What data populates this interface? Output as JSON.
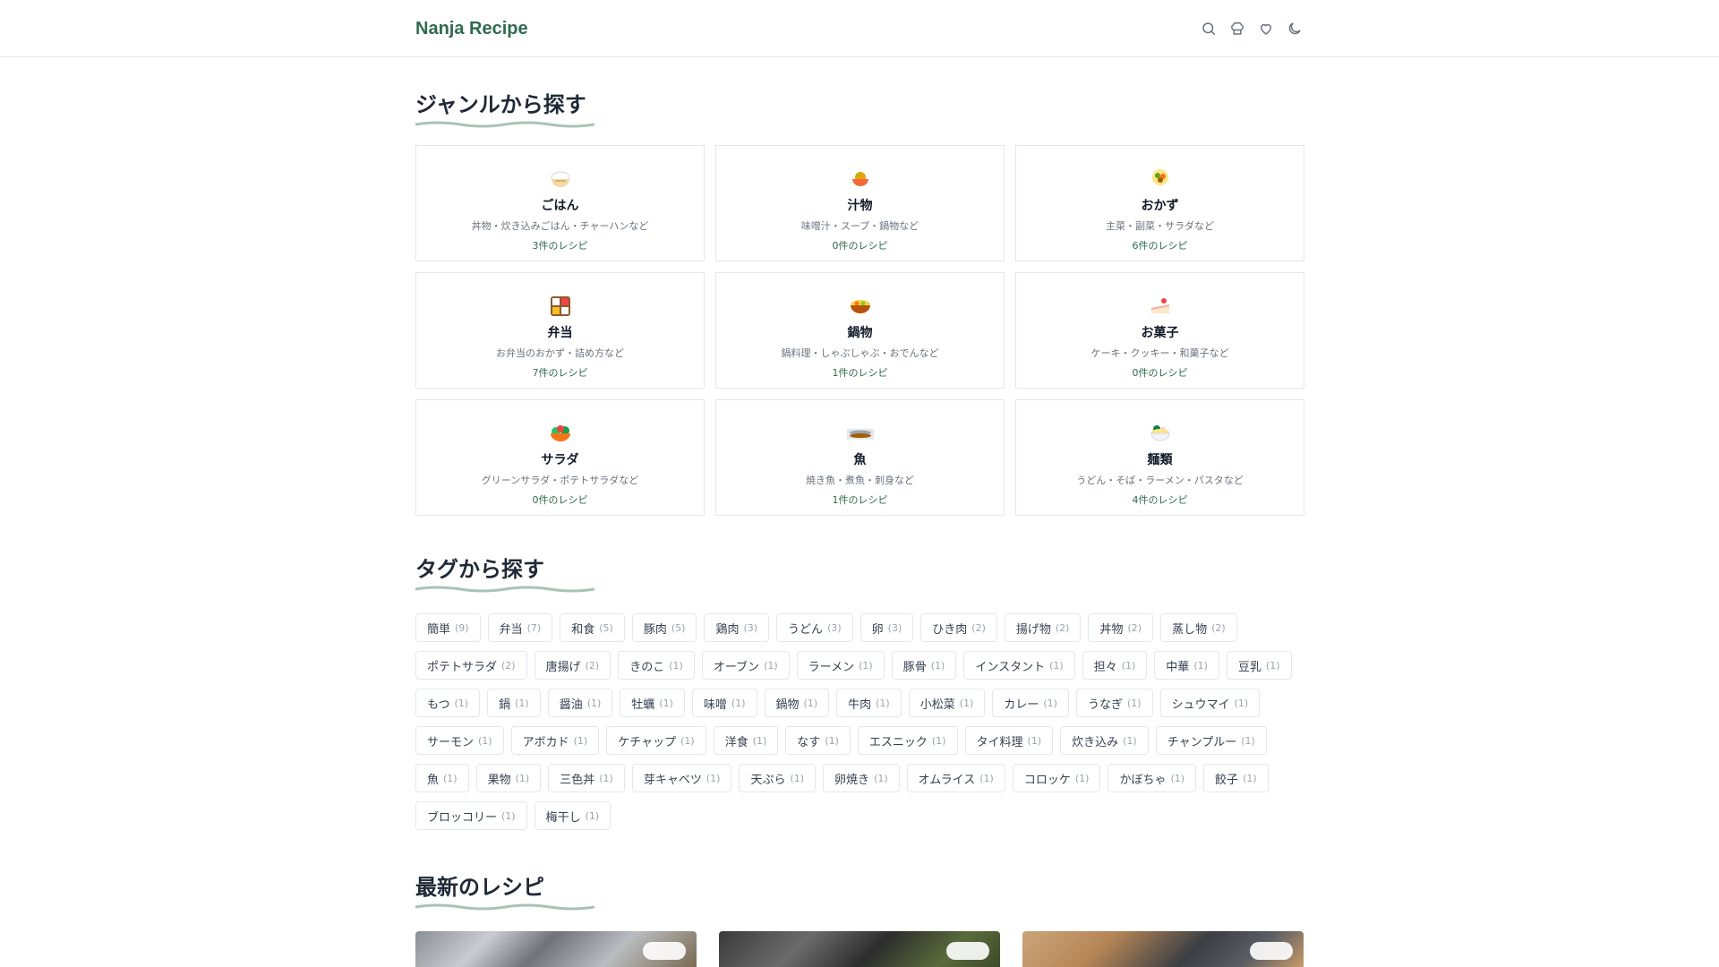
{
  "header": {
    "logo": "Nanja Recipe",
    "icons": [
      "search-icon",
      "chef-icon",
      "heart-icon",
      "moon-icon"
    ]
  },
  "genres_section": {
    "title": "ジャンルから探す",
    "items": [
      {
        "name": "ごはん",
        "desc": "丼物・炊き込みごはん・チャーハンなど",
        "count": "3件のレシピ",
        "icon": "rice-bowl-icon"
      },
      {
        "name": "汁物",
        "desc": "味噌汁・スープ・鍋物など",
        "count": "0件のレシピ",
        "icon": "soup-icon"
      },
      {
        "name": "おかず",
        "desc": "主菜・副菜・サラダなど",
        "count": "6件のレシピ",
        "icon": "side-dish-icon"
      },
      {
        "name": "弁当",
        "desc": "お弁当のおかず・詰め方など",
        "count": "7件のレシピ",
        "icon": "bento-icon"
      },
      {
        "name": "鍋物",
        "desc": "鍋料理・しゃぶしゃぶ・おでんなど",
        "count": "1件のレシピ",
        "icon": "hotpot-icon"
      },
      {
        "name": "お菓子",
        "desc": "ケーキ・クッキー・和菓子など",
        "count": "0件のレシピ",
        "icon": "cake-icon"
      },
      {
        "name": "サラダ",
        "desc": "グリーンサラダ・ポテトサラダなど",
        "count": "0件のレシピ",
        "icon": "salad-icon"
      },
      {
        "name": "魚",
        "desc": "焼き魚・煮魚・刺身など",
        "count": "1件のレシピ",
        "icon": "fish-icon"
      },
      {
        "name": "麺類",
        "desc": "うどん・そば・ラーメン・パスタなど",
        "count": "4件のレシピ",
        "icon": "noodles-icon"
      }
    ]
  },
  "tags_section": {
    "title": "タグから探す",
    "tags": [
      {
        "label": "簡単",
        "count": "(9)"
      },
      {
        "label": "弁当",
        "count": "(7)"
      },
      {
        "label": "和食",
        "count": "(5)"
      },
      {
        "label": "豚肉",
        "count": "(5)"
      },
      {
        "label": "鶏肉",
        "count": "(3)"
      },
      {
        "label": "うどん",
        "count": "(3)"
      },
      {
        "label": "卵",
        "count": "(3)"
      },
      {
        "label": "ひき肉",
        "count": "(2)"
      },
      {
        "label": "揚げ物",
        "count": "(2)"
      },
      {
        "label": "丼物",
        "count": "(2)"
      },
      {
        "label": "蒸し物",
        "count": "(2)"
      },
      {
        "label": "ポテトサラダ",
        "count": "(2)"
      },
      {
        "label": "唐揚げ",
        "count": "(2)"
      },
      {
        "label": "きのこ",
        "count": "(1)"
      },
      {
        "label": "オーブン",
        "count": "(1)"
      },
      {
        "label": "ラーメン",
        "count": "(1)"
      },
      {
        "label": "豚骨",
        "count": "(1)"
      },
      {
        "label": "インスタント",
        "count": "(1)"
      },
      {
        "label": "担々",
        "count": "(1)"
      },
      {
        "label": "中華",
        "count": "(1)"
      },
      {
        "label": "豆乳",
        "count": "(1)"
      },
      {
        "label": "もつ",
        "count": "(1)"
      },
      {
        "label": "鍋",
        "count": "(1)"
      },
      {
        "label": "醤油",
        "count": "(1)"
      },
      {
        "label": "牡蠣",
        "count": "(1)"
      },
      {
        "label": "味噌",
        "count": "(1)"
      },
      {
        "label": "鍋物",
        "count": "(1)"
      },
      {
        "label": "牛肉",
        "count": "(1)"
      },
      {
        "label": "小松菜",
        "count": "(1)"
      },
      {
        "label": "カレー",
        "count": "(1)"
      },
      {
        "label": "うなぎ",
        "count": "(1)"
      },
      {
        "label": "シュウマイ",
        "count": "(1)"
      },
      {
        "label": "サーモン",
        "count": "(1)"
      },
      {
        "label": "アボカド",
        "count": "(1)"
      },
      {
        "label": "ケチャップ",
        "count": "(1)"
      },
      {
        "label": "洋食",
        "count": "(1)"
      },
      {
        "label": "なす",
        "count": "(1)"
      },
      {
        "label": "エスニック",
        "count": "(1)"
      },
      {
        "label": "タイ料理",
        "count": "(1)"
      },
      {
        "label": "炊き込み",
        "count": "(1)"
      },
      {
        "label": "チャンプルー",
        "count": "(1)"
      },
      {
        "label": "魚",
        "count": "(1)"
      },
      {
        "label": "果物",
        "count": "(1)"
      },
      {
        "label": "三色丼",
        "count": "(1)"
      },
      {
        "label": "芽キャベツ",
        "count": "(1)"
      },
      {
        "label": "天ぷら",
        "count": "(1)"
      },
      {
        "label": "卵焼き",
        "count": "(1)"
      },
      {
        "label": "オムライス",
        "count": "(1)"
      },
      {
        "label": "コロッケ",
        "count": "(1)"
      },
      {
        "label": "かぼちゃ",
        "count": "(1)"
      },
      {
        "label": "餃子",
        "count": "(1)"
      },
      {
        "label": "ブロッコリー",
        "count": "(1)"
      },
      {
        "label": "梅干し",
        "count": "(1)"
      }
    ]
  },
  "latest_section": {
    "title": "最新のレシピ"
  },
  "colors": {
    "accent": "#2f6b4f",
    "underline": "#a7c4b5"
  }
}
